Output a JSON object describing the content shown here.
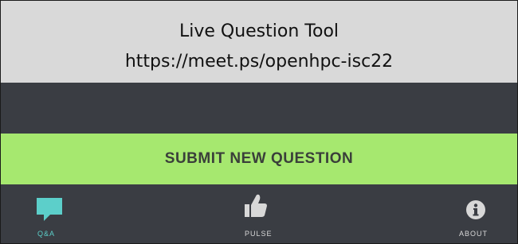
{
  "banner": {
    "title": "Live Question Tool",
    "url": "https://meet.ps/openhpc-isc22"
  },
  "submit": {
    "label": "SUBMIT NEW QUESTION"
  },
  "tabs": [
    {
      "label": "Q&A",
      "icon": "speech-bubble-icon",
      "active": true
    },
    {
      "label": "PULSE",
      "icon": "thumbs-up-icon",
      "active": false
    },
    {
      "label": "ABOUT",
      "icon": "info-icon",
      "active": false
    }
  ],
  "colors": {
    "banner_bg": "#d9d9d9",
    "app_bg": "#3a3d43",
    "accent_green": "#a6e86f",
    "active_tab": "#5ccfca",
    "inactive_tab": "#d8d8d8"
  }
}
